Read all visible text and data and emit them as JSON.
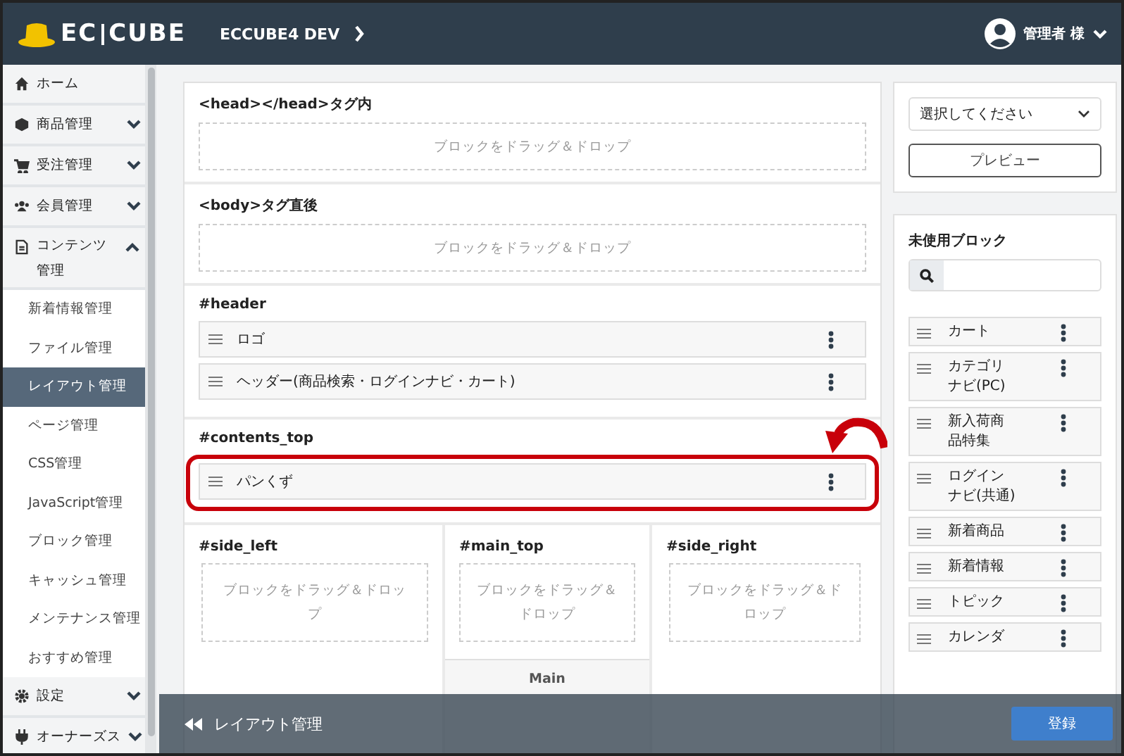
{
  "header": {
    "logo": [
      "EC",
      "CUBE"
    ],
    "site_name": "ECCUBE4 DEV",
    "user": "管理者 様"
  },
  "sidebar": {
    "items": [
      {
        "label": "ホーム"
      },
      {
        "label": "商品管理",
        "expanded": false
      },
      {
        "label": "受注管理",
        "expanded": false
      },
      {
        "label": "会員管理",
        "expanded": false
      },
      {
        "label": "コンテンツ管理",
        "expanded": true,
        "children": [
          {
            "label": "新着情報管理",
            "selected": false
          },
          {
            "label": "ファイル管理",
            "selected": false
          },
          {
            "label": "レイアウト管理",
            "selected": true
          },
          {
            "label": "ページ管理",
            "selected": false
          },
          {
            "label": "CSS管理",
            "selected": false
          },
          {
            "label": "JavaScript管理",
            "selected": false
          },
          {
            "label": "ブロック管理",
            "selected": false
          },
          {
            "label": "キャッシュ管理",
            "selected": false
          },
          {
            "label": "メンテナンス管理",
            "selected": false
          },
          {
            "label": "おすすめ管理",
            "selected": false
          }
        ]
      },
      {
        "label": "設定",
        "expanded": false
      },
      {
        "label": "オーナーズス",
        "expanded": false
      }
    ]
  },
  "layout": {
    "sections": [
      {
        "kind": "dropzone",
        "title": "<head></head>タグ内",
        "placeholder": "ブロックをドラッグ＆ドロップ"
      },
      {
        "kind": "dropzone",
        "title": "<body>タグ直後",
        "placeholder": "ブロックをドラッグ＆ドロップ"
      },
      {
        "kind": "blocks",
        "title": "#header",
        "blocks": [
          {
            "label": "ロゴ",
            "highlighted": false
          },
          {
            "label": "ヘッダー(商品検索・ログインナビ・カート)",
            "highlighted": false
          }
        ]
      },
      {
        "kind": "blocks",
        "title": "#contents_top",
        "blocks": [
          {
            "label": "パンくず",
            "highlighted": true
          }
        ]
      }
    ],
    "columns": [
      {
        "title": "#side_left",
        "placeholder": "ブロックをドラッグ＆ドロップ"
      },
      {
        "title": "#main_top",
        "placeholder": "ブロックをドラッグ＆ドロップ"
      },
      {
        "title": "#side_right",
        "placeholder": "ブロックをドラッグ＆ドロップ"
      }
    ],
    "main_label": "Main"
  },
  "side_panel": {
    "select": "選択してください",
    "preview_button": "プレビュー",
    "unused_title": "未使用ブロック",
    "blocks": [
      {
        "label": "カート"
      },
      {
        "label": "カテゴリナビ(PC)"
      },
      {
        "label": "新入荷商品特集"
      },
      {
        "label": "ログインナビ(共通)"
      },
      {
        "label": "新着商品"
      },
      {
        "label": "新着情報"
      },
      {
        "label": "トピック"
      },
      {
        "label": "カレンダ"
      }
    ]
  },
  "footer_bar": {
    "back_label": "レイアウト管理",
    "submit_button": "登録"
  }
}
